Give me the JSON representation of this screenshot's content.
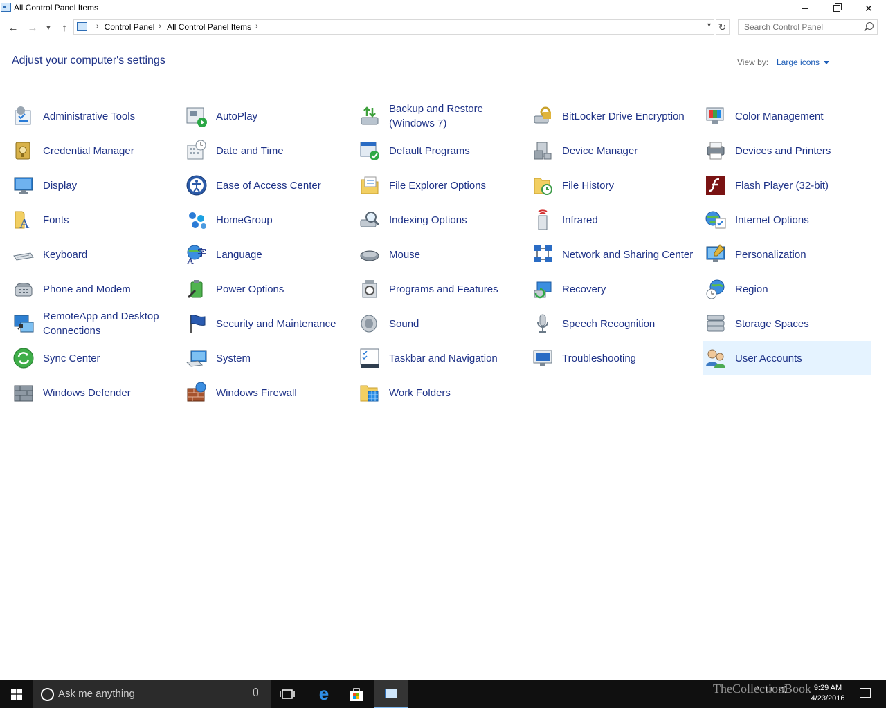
{
  "window": {
    "title": "All Control Panel Items"
  },
  "address": {
    "crumbs": [
      "Control Panel",
      "All Control Panel Items"
    ]
  },
  "search": {
    "placeholder": "Search Control Panel"
  },
  "header": {
    "title": "Adjust your computer's settings",
    "view_by_label": "View by:",
    "view_by_value": "Large icons"
  },
  "items": [
    {
      "label": "Administrative Tools",
      "icon": "admin-tools-icon"
    },
    {
      "label": "AutoPlay",
      "icon": "autoplay-icon"
    },
    {
      "label": "Backup and Restore (Windows 7)",
      "icon": "backup-restore-icon"
    },
    {
      "label": "BitLocker Drive Encryption",
      "icon": "bitlocker-icon"
    },
    {
      "label": "Color Management",
      "icon": "color-management-icon"
    },
    {
      "label": "Credential Manager",
      "icon": "credential-manager-icon"
    },
    {
      "label": "Date and Time",
      "icon": "date-time-icon"
    },
    {
      "label": "Default Programs",
      "icon": "default-programs-icon"
    },
    {
      "label": "Device Manager",
      "icon": "device-manager-icon"
    },
    {
      "label": "Devices and Printers",
      "icon": "devices-printers-icon"
    },
    {
      "label": "Display",
      "icon": "display-icon"
    },
    {
      "label": "Ease of Access Center",
      "icon": "ease-of-access-icon"
    },
    {
      "label": "File Explorer Options",
      "icon": "file-explorer-options-icon"
    },
    {
      "label": "File History",
      "icon": "file-history-icon"
    },
    {
      "label": "Flash Player (32-bit)",
      "icon": "flash-player-icon"
    },
    {
      "label": "Fonts",
      "icon": "fonts-icon"
    },
    {
      "label": "HomeGroup",
      "icon": "homegroup-icon"
    },
    {
      "label": "Indexing Options",
      "icon": "indexing-options-icon"
    },
    {
      "label": "Infrared",
      "icon": "infrared-icon"
    },
    {
      "label": "Internet Options",
      "icon": "internet-options-icon"
    },
    {
      "label": "Keyboard",
      "icon": "keyboard-icon"
    },
    {
      "label": "Language",
      "icon": "language-icon"
    },
    {
      "label": "Mouse",
      "icon": "mouse-icon"
    },
    {
      "label": "Network and Sharing Center",
      "icon": "network-sharing-icon"
    },
    {
      "label": "Personalization",
      "icon": "personalization-icon"
    },
    {
      "label": "Phone and Modem",
      "icon": "phone-modem-icon"
    },
    {
      "label": "Power Options",
      "icon": "power-options-icon"
    },
    {
      "label": "Programs and Features",
      "icon": "programs-features-icon"
    },
    {
      "label": "Recovery",
      "icon": "recovery-icon"
    },
    {
      "label": "Region",
      "icon": "region-icon"
    },
    {
      "label": "RemoteApp and Desktop Connections",
      "icon": "remoteapp-icon"
    },
    {
      "label": "Security and Maintenance",
      "icon": "security-maintenance-icon"
    },
    {
      "label": "Sound",
      "icon": "sound-icon"
    },
    {
      "label": "Speech Recognition",
      "icon": "speech-recognition-icon"
    },
    {
      "label": "Storage Spaces",
      "icon": "storage-spaces-icon"
    },
    {
      "label": "Sync Center",
      "icon": "sync-center-icon"
    },
    {
      "label": "System",
      "icon": "system-icon"
    },
    {
      "label": "Taskbar and Navigation",
      "icon": "taskbar-navigation-icon"
    },
    {
      "label": "Troubleshooting",
      "icon": "troubleshooting-icon"
    },
    {
      "label": "User Accounts",
      "icon": "user-accounts-icon",
      "selected": true
    },
    {
      "label": "Windows Defender",
      "icon": "windows-defender-icon"
    },
    {
      "label": "Windows Firewall",
      "icon": "windows-firewall-icon"
    },
    {
      "label": "Work Folders",
      "icon": "work-folders-icon"
    }
  ],
  "taskbar": {
    "search_placeholder": "Ask me anything",
    "time": "9:29 AM",
    "date": "4/23/2016",
    "watermark": "TheCollectionBook"
  },
  "colors": {
    "link": "#1e3287",
    "selected_bg": "#e5f3ff",
    "accent": "#1e5eb8"
  }
}
